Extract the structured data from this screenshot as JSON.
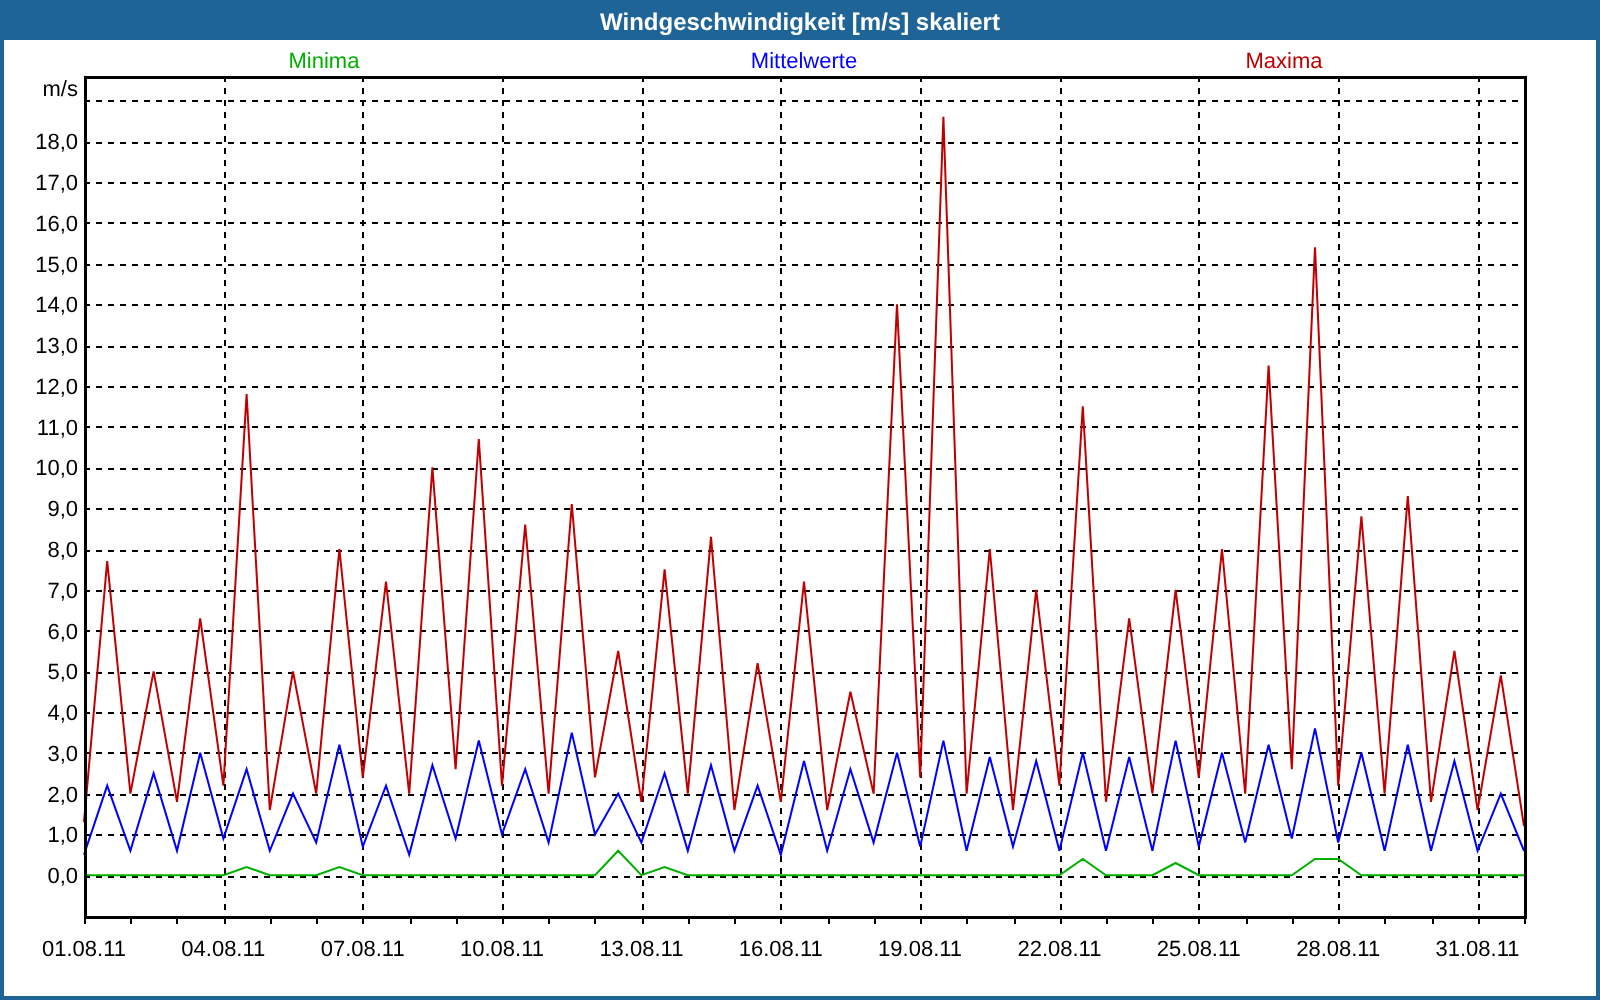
{
  "window": {
    "title": "Windgeschwindigkeit [m/s] skaliert"
  },
  "chart": {
    "chart_data": {
      "type": "line",
      "ylabel": "m/s",
      "categories": [
        "01.08.11",
        null,
        null,
        null,
        null,
        null,
        "04.08.11",
        null,
        null,
        null,
        null,
        null,
        "07.08.11",
        null,
        null,
        null,
        null,
        null,
        "10.08.11",
        null,
        null,
        null,
        null,
        null,
        "13.08.11",
        null,
        null,
        null,
        null,
        null,
        "16.08.11",
        null,
        null,
        null,
        null,
        null,
        "19.08.11",
        null,
        null,
        null,
        null,
        null,
        "22.08.11",
        null,
        null,
        null,
        null,
        null,
        "25.08.11",
        null,
        null,
        null,
        null,
        null,
        "28.08.11",
        null,
        null,
        null,
        null,
        null,
        "31.08.11",
        null,
        null
      ],
      "series": [
        {
          "name": "Minima",
          "color": "#00b000",
          "values": [
            0,
            0,
            0,
            0,
            0,
            0,
            0,
            0.2,
            0,
            0,
            0,
            0.2,
            0,
            0,
            0,
            0,
            0,
            0,
            0,
            0,
            0,
            0,
            0,
            0.6,
            0,
            0.2,
            0,
            0,
            0,
            0,
            0,
            0,
            0,
            0,
            0,
            0,
            0,
            0,
            0,
            0,
            0,
            0,
            0,
            0.4,
            0,
            0,
            0,
            0.3,
            0,
            0,
            0,
            0,
            0,
            0.4,
            0.4,
            0,
            0,
            0,
            0,
            0,
            0,
            0,
            0
          ]
        },
        {
          "name": "Mittelwerte",
          "color": "#0000ff",
          "values": [
            0.5,
            2.2,
            0.6,
            2.5,
            0.6,
            3.0,
            0.9,
            2.6,
            0.6,
            2.0,
            0.8,
            3.2,
            0.7,
            2.2,
            0.5,
            2.7,
            0.9,
            3.3,
            1.0,
            2.6,
            0.8,
            3.5,
            1.0,
            2.0,
            0.8,
            2.5,
            0.6,
            2.7,
            0.6,
            2.2,
            0.5,
            2.8,
            0.6,
            2.6,
            0.8,
            3.0,
            0.7,
            3.3,
            0.6,
            2.9,
            0.7,
            2.8,
            0.6,
            3.0,
            0.6,
            2.9,
            0.6,
            3.3,
            0.7,
            3.0,
            0.8,
            3.2,
            0.9,
            3.6,
            0.8,
            3.0,
            0.6,
            3.2,
            0.6,
            2.8,
            0.6,
            2.0,
            0.6
          ]
        },
        {
          "name": "Maxima",
          "color": "#c00000",
          "values": [
            1.3,
            7.7,
            2.0,
            5.0,
            1.8,
            6.3,
            2.2,
            11.8,
            1.6,
            5.0,
            2.0,
            8.0,
            2.4,
            7.2,
            2.0,
            10.0,
            2.6,
            10.7,
            2.2,
            8.6,
            2.0,
            9.1,
            2.4,
            5.5,
            1.8,
            7.5,
            2.0,
            8.3,
            1.6,
            5.2,
            1.8,
            7.2,
            1.6,
            4.5,
            2.0,
            14.0,
            2.4,
            18.6,
            2.0,
            8.0,
            1.6,
            7.0,
            2.2,
            11.5,
            1.8,
            6.3,
            2.0,
            7.0,
            2.4,
            8.0,
            2.0,
            12.5,
            2.6,
            15.4,
            2.2,
            8.8,
            2.0,
            9.3,
            1.8,
            5.5,
            1.6,
            4.9,
            1.2
          ]
        }
      ],
      "ylim": [
        -1,
        19.6
      ],
      "grid": true,
      "yticks": [
        {
          "value": 0,
          "label": "0,0"
        },
        {
          "value": 1,
          "label": "1,0"
        },
        {
          "value": 2,
          "label": "2,0"
        },
        {
          "value": 3,
          "label": "3,0"
        },
        {
          "value": 4,
          "label": "4,0"
        },
        {
          "value": 5,
          "label": "5,0"
        },
        {
          "value": 6,
          "label": "6,0"
        },
        {
          "value": 7,
          "label": "7,0"
        },
        {
          "value": 8,
          "label": "8,0"
        },
        {
          "value": 9,
          "label": "9,0"
        },
        {
          "value": 10,
          "label": "10,0"
        },
        {
          "value": 11,
          "label": "11,0"
        },
        {
          "value": 12,
          "label": "12,0"
        },
        {
          "value": 13,
          "label": "13,0"
        },
        {
          "value": 14,
          "label": "14,0"
        },
        {
          "value": 15,
          "label": "15,0"
        },
        {
          "value": 16,
          "label": "16,0"
        },
        {
          "value": 17,
          "label": "17,0"
        },
        {
          "value": 18,
          "label": "18,0"
        }
      ]
    }
  }
}
